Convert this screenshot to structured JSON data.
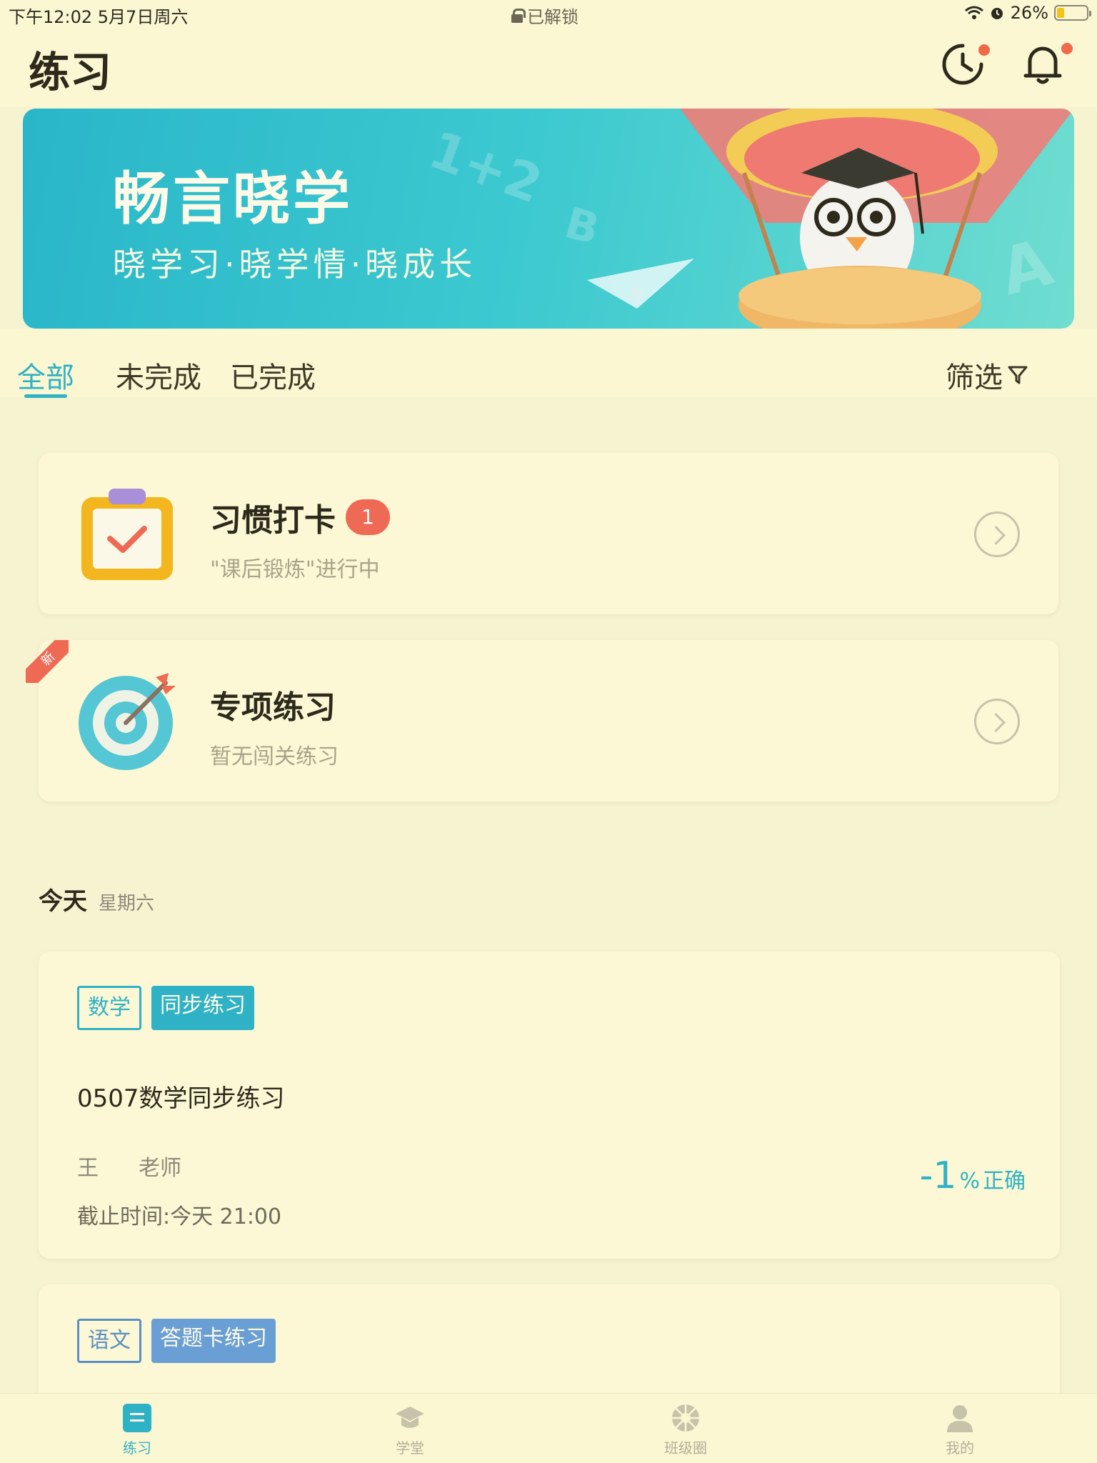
{
  "status_bar": {
    "time": "下午12:02   5月7日周六",
    "lock_label": "已解锁",
    "battery": "26%",
    "battery_level": 0.26
  },
  "header": {
    "title": "练习",
    "icons": [
      "history-icon",
      "bell-icon"
    ]
  },
  "banner": {
    "title": "畅言晓学",
    "subtitle": "晓学习·晓学情·晓成长"
  },
  "tabs": [
    {
      "label": "全部",
      "active": true
    },
    {
      "label": "未完成",
      "active": false
    },
    {
      "label": "已完成",
      "active": false
    }
  ],
  "filter_label": "筛选",
  "entries": [
    {
      "title": "习惯打卡",
      "badge": "1",
      "subtitle": "\"课后锻炼\"进行中",
      "icon": "clipboard-check-icon"
    },
    {
      "title": "专项练习",
      "ribbon": "新",
      "subtitle": "暂无闯关练习",
      "icon": "target-icon"
    }
  ],
  "section": {
    "title": "今天",
    "subtitle": "星期六"
  },
  "practices": [
    {
      "subject": "数学",
      "type": "同步练习",
      "title": "0507数学同步练习",
      "teacher_name": "王",
      "teacher_role": "老师",
      "deadline": "截止时间:今天 21:00",
      "score": "-1",
      "score_unit": "%",
      "score_label": "正确"
    },
    {
      "subject": "语文",
      "type": "答题卡练习"
    }
  ],
  "bottom_nav": [
    {
      "label": "练习",
      "icon": "list-icon",
      "active": true
    },
    {
      "label": "学堂",
      "icon": "graduation-cap-icon",
      "active": false
    },
    {
      "label": "班级圈",
      "icon": "aperture-icon",
      "active": false
    },
    {
      "label": "我的",
      "icon": "person-icon",
      "active": false
    }
  ],
  "colors": {
    "accent": "#2fb2c6",
    "background": "#f6f3d1",
    "badge": "#ef6a55"
  }
}
